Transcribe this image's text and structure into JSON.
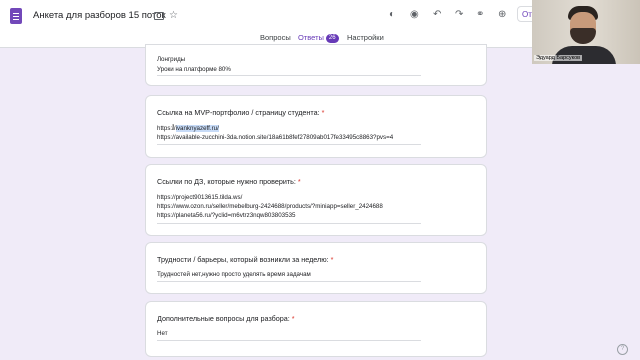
{
  "header": {
    "title": "Анкета для разборов 15 поток",
    "send_label": "От"
  },
  "tabs": [
    {
      "label": "Вопросы"
    },
    {
      "label": "Ответы",
      "badge": "26"
    },
    {
      "label": "Настройки"
    }
  ],
  "video": {
    "name": "Эдуард Барсуков"
  },
  "cards": [
    {
      "answer_lines": [
        "Лонгриды",
        "Уроки на платформе 80%"
      ]
    },
    {
      "title": "Ссылка на MVP-портфолио / страницу студента:",
      "required_mark": "*",
      "answer_lines": [
        "https://ivanknyazeff.ru/",
        "https://available-zucchini-3da.notion.site/18a61b8fef27809ab017fe33495c8863?pvs=4"
      ]
    },
    {
      "title": "Ссылки по ДЗ, которые нужно проверить:",
      "required_mark": "*",
      "answer_lines": [
        "https://project9013615.tilda.ws/",
        "https://www.ozon.ru/seller/mebelburg-2424688/products/?miniapp=seller_2424688",
        "https://planeta56.ru/?yclid=m6vtrz3nqw803803535"
      ]
    },
    {
      "title": "Трудности / барьеры, который возникли за неделю:",
      "required_mark": "*",
      "answer_lines": [
        "Трудностей нет,нужно просто уделять время задачам"
      ]
    },
    {
      "title": "Дополнительные вопросы для разбора:",
      "required_mark": "*",
      "answer_lines": [
        "Нет"
      ]
    }
  ],
  "icons": [
    "forms-app-icon",
    "folder-icon",
    "star-icon",
    "palette-icon",
    "preview-icon",
    "undo-icon",
    "redo-icon",
    "link-icon",
    "add-collaborator-icon",
    "help-icon"
  ],
  "colors": {
    "accent": "#673ab7",
    "background": "#f0ebf8",
    "required": "#d93025"
  }
}
